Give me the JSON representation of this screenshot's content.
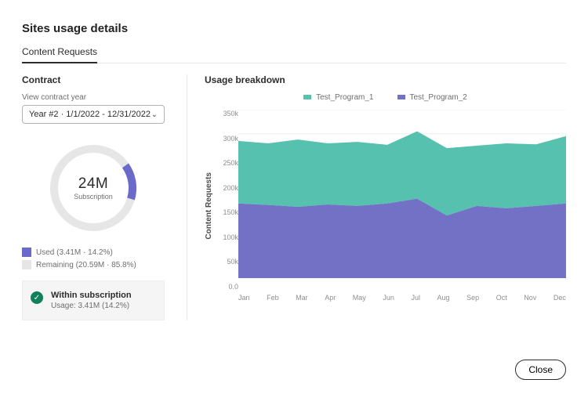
{
  "page_title": "Sites usage details",
  "tabs": [
    {
      "label": "Content Requests",
      "active": true
    }
  ],
  "contract": {
    "title": "Contract",
    "year_selector": {
      "label": "View contract year",
      "selected": "Year #2  ·  1/1/2022 - 12/31/2022"
    },
    "subscription_value": "24M",
    "subscription_caption": "Subscription",
    "used_legend": "Used (3.41M · 14.2%)",
    "remaining_legend": "Remaining (20.59M · 85.8%)",
    "donut": {
      "used_percent": 14.2
    },
    "status": {
      "title": "Within subscription",
      "detail": "Usage: 3.41M (14.2%)"
    }
  },
  "breakdown": {
    "title": "Usage breakdown",
    "legend_series1": "Test_Program_1",
    "legend_series2": "Test_Program_2",
    "y_label": "Content Requests",
    "y_ticks": [
      "350k",
      "300k",
      "250k",
      "200k",
      "150k",
      "100k",
      "50k",
      "0.0"
    ],
    "x_ticks": [
      "Jan",
      "Feb",
      "Mar",
      "Apr",
      "May",
      "Jun",
      "Jul",
      "Aug",
      "Sep",
      "Oct",
      "Nov",
      "Dec"
    ]
  },
  "buttons": {
    "close": "Close"
  },
  "chart_data": {
    "type": "area",
    "title": "Usage breakdown",
    "xlabel": "",
    "ylabel": "Content Requests",
    "ylim": [
      0,
      350000
    ],
    "categories": [
      "Jan",
      "Feb",
      "Mar",
      "Apr",
      "May",
      "Jun",
      "Jul",
      "Aug",
      "Sep",
      "Oct",
      "Nov",
      "Dec"
    ],
    "series": [
      {
        "name": "Test_Program_2",
        "color": "#7371c6",
        "values": [
          155000,
          152000,
          148000,
          153000,
          150000,
          155000,
          165000,
          130000,
          150000,
          145000,
          150000,
          155000
        ]
      },
      {
        "name": "Test_Program_1",
        "color": "#57c1b0",
        "values": [
          130000,
          128000,
          140000,
          127000,
          133000,
          122000,
          140000,
          140000,
          125000,
          135000,
          128000,
          140000
        ]
      }
    ],
    "stacked_totals": [
      285000,
      280000,
      288000,
      280000,
      283000,
      277000,
      305000,
      270000,
      275000,
      280000,
      278000,
      295000
    ]
  }
}
